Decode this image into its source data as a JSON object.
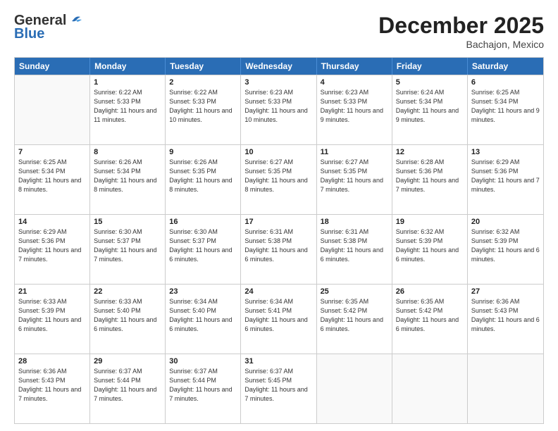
{
  "header": {
    "logo_general": "General",
    "logo_blue": "Blue",
    "month_title": "December 2025",
    "location": "Bachajon, Mexico"
  },
  "days_of_week": [
    "Sunday",
    "Monday",
    "Tuesday",
    "Wednesday",
    "Thursday",
    "Friday",
    "Saturday"
  ],
  "weeks": [
    [
      {
        "day": "",
        "sunrise": "",
        "sunset": "",
        "daylight": "",
        "empty": true
      },
      {
        "day": "1",
        "sunrise": "6:22 AM",
        "sunset": "5:33 PM",
        "daylight": "11 hours and 11 minutes."
      },
      {
        "day": "2",
        "sunrise": "6:22 AM",
        "sunset": "5:33 PM",
        "daylight": "11 hours and 10 minutes."
      },
      {
        "day": "3",
        "sunrise": "6:23 AM",
        "sunset": "5:33 PM",
        "daylight": "11 hours and 10 minutes."
      },
      {
        "day": "4",
        "sunrise": "6:23 AM",
        "sunset": "5:33 PM",
        "daylight": "11 hours and 9 minutes."
      },
      {
        "day": "5",
        "sunrise": "6:24 AM",
        "sunset": "5:34 PM",
        "daylight": "11 hours and 9 minutes."
      },
      {
        "day": "6",
        "sunrise": "6:25 AM",
        "sunset": "5:34 PM",
        "daylight": "11 hours and 9 minutes."
      }
    ],
    [
      {
        "day": "7",
        "sunrise": "6:25 AM",
        "sunset": "5:34 PM",
        "daylight": "11 hours and 8 minutes."
      },
      {
        "day": "8",
        "sunrise": "6:26 AM",
        "sunset": "5:34 PM",
        "daylight": "11 hours and 8 minutes."
      },
      {
        "day": "9",
        "sunrise": "6:26 AM",
        "sunset": "5:35 PM",
        "daylight": "11 hours and 8 minutes."
      },
      {
        "day": "10",
        "sunrise": "6:27 AM",
        "sunset": "5:35 PM",
        "daylight": "11 hours and 8 minutes."
      },
      {
        "day": "11",
        "sunrise": "6:27 AM",
        "sunset": "5:35 PM",
        "daylight": "11 hours and 7 minutes."
      },
      {
        "day": "12",
        "sunrise": "6:28 AM",
        "sunset": "5:36 PM",
        "daylight": "11 hours and 7 minutes."
      },
      {
        "day": "13",
        "sunrise": "6:29 AM",
        "sunset": "5:36 PM",
        "daylight": "11 hours and 7 minutes."
      }
    ],
    [
      {
        "day": "14",
        "sunrise": "6:29 AM",
        "sunset": "5:36 PM",
        "daylight": "11 hours and 7 minutes."
      },
      {
        "day": "15",
        "sunrise": "6:30 AM",
        "sunset": "5:37 PM",
        "daylight": "11 hours and 7 minutes."
      },
      {
        "day": "16",
        "sunrise": "6:30 AM",
        "sunset": "5:37 PM",
        "daylight": "11 hours and 6 minutes."
      },
      {
        "day": "17",
        "sunrise": "6:31 AM",
        "sunset": "5:38 PM",
        "daylight": "11 hours and 6 minutes."
      },
      {
        "day": "18",
        "sunrise": "6:31 AM",
        "sunset": "5:38 PM",
        "daylight": "11 hours and 6 minutes."
      },
      {
        "day": "19",
        "sunrise": "6:32 AM",
        "sunset": "5:39 PM",
        "daylight": "11 hours and 6 minutes."
      },
      {
        "day": "20",
        "sunrise": "6:32 AM",
        "sunset": "5:39 PM",
        "daylight": "11 hours and 6 minutes."
      }
    ],
    [
      {
        "day": "21",
        "sunrise": "6:33 AM",
        "sunset": "5:39 PM",
        "daylight": "11 hours and 6 minutes."
      },
      {
        "day": "22",
        "sunrise": "6:33 AM",
        "sunset": "5:40 PM",
        "daylight": "11 hours and 6 minutes."
      },
      {
        "day": "23",
        "sunrise": "6:34 AM",
        "sunset": "5:40 PM",
        "daylight": "11 hours and 6 minutes."
      },
      {
        "day": "24",
        "sunrise": "6:34 AM",
        "sunset": "5:41 PM",
        "daylight": "11 hours and 6 minutes."
      },
      {
        "day": "25",
        "sunrise": "6:35 AM",
        "sunset": "5:42 PM",
        "daylight": "11 hours and 6 minutes."
      },
      {
        "day": "26",
        "sunrise": "6:35 AM",
        "sunset": "5:42 PM",
        "daylight": "11 hours and 6 minutes."
      },
      {
        "day": "27",
        "sunrise": "6:36 AM",
        "sunset": "5:43 PM",
        "daylight": "11 hours and 6 minutes."
      }
    ],
    [
      {
        "day": "28",
        "sunrise": "6:36 AM",
        "sunset": "5:43 PM",
        "daylight": "11 hours and 7 minutes."
      },
      {
        "day": "29",
        "sunrise": "6:37 AM",
        "sunset": "5:44 PM",
        "daylight": "11 hours and 7 minutes."
      },
      {
        "day": "30",
        "sunrise": "6:37 AM",
        "sunset": "5:44 PM",
        "daylight": "11 hours and 7 minutes."
      },
      {
        "day": "31",
        "sunrise": "6:37 AM",
        "sunset": "5:45 PM",
        "daylight": "11 hours and 7 minutes."
      },
      {
        "day": "",
        "sunrise": "",
        "sunset": "",
        "daylight": "",
        "empty": true
      },
      {
        "day": "",
        "sunrise": "",
        "sunset": "",
        "daylight": "",
        "empty": true
      },
      {
        "day": "",
        "sunrise": "",
        "sunset": "",
        "daylight": "",
        "empty": true
      }
    ]
  ],
  "labels": {
    "sunrise_prefix": "Sunrise: ",
    "sunset_prefix": "Sunset: ",
    "daylight_prefix": "Daylight: "
  }
}
